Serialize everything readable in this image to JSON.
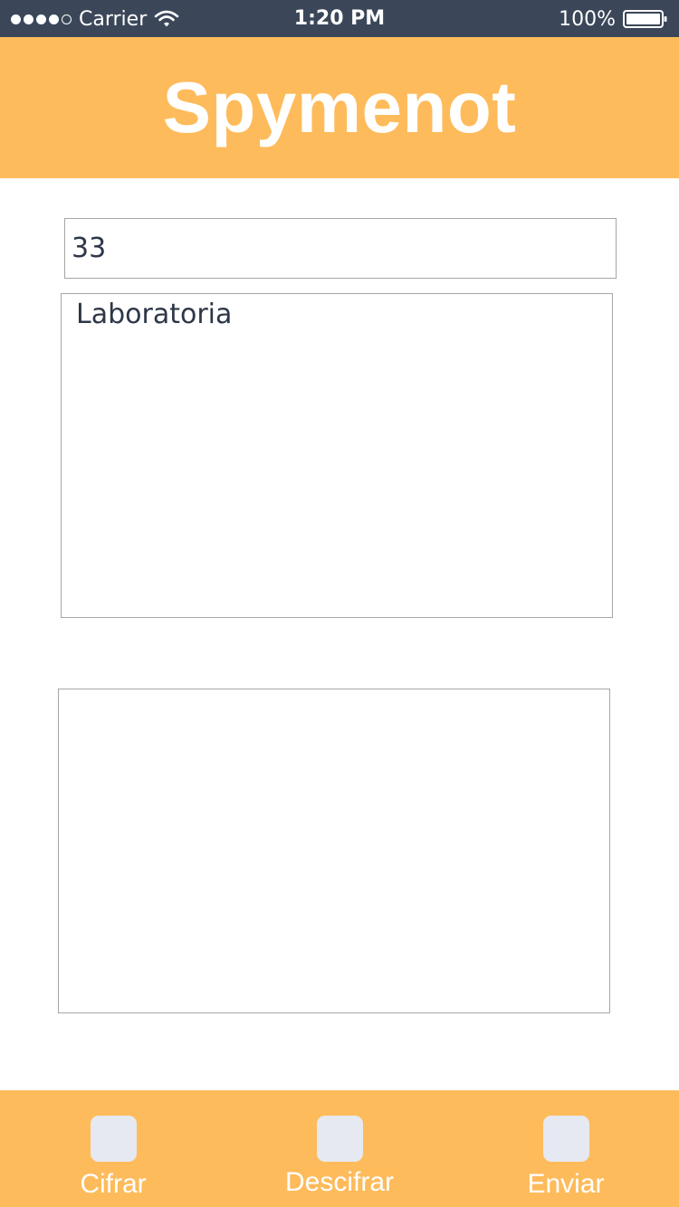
{
  "status_bar": {
    "carrier": "Carrier",
    "time": "1:20 PM",
    "battery": "100%",
    "signal_bars": 4,
    "signal_max": 5
  },
  "header": {
    "title": "Spymenot",
    "background_color": "#febb5b"
  },
  "form": {
    "key_value": "33",
    "message_value": "Laboratoria",
    "result_value": ""
  },
  "tab_bar": {
    "tabs": [
      {
        "label": "Cifrar",
        "icon": "square-icon"
      },
      {
        "label": "Descifrar",
        "icon": "square-icon"
      },
      {
        "label": "Enviar",
        "icon": "square-icon"
      }
    ]
  },
  "colors": {
    "accent": "#febb5b",
    "status_bar": "#3b4759",
    "text": "#2d3748",
    "tab_icon": "#e6e9f1"
  }
}
